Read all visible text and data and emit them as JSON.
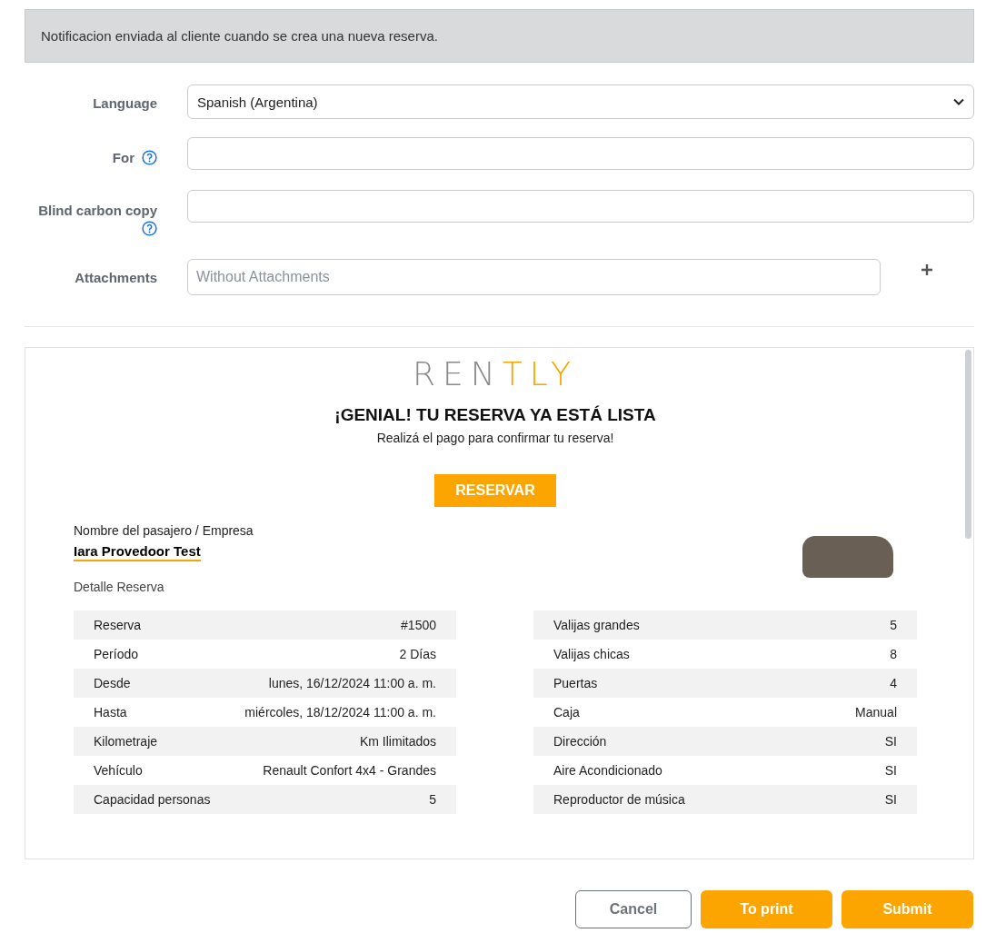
{
  "notice": "Notificacion enviada al cliente cuando se crea una nueva reserva.",
  "form": [
    {
      "kind": "select",
      "label": "Language",
      "value": "Spanish (Argentina)",
      "help": false
    },
    {
      "kind": "text",
      "label": "For",
      "help": true
    },
    {
      "kind": "text",
      "label": "Blind carbon copy",
      "help": true
    },
    {
      "kind": "attach",
      "label": "Attachments",
      "placeholder": "Without Attachments",
      "help": false
    }
  ],
  "preview": {
    "logo": {
      "main": "REN",
      "accent": "TLY"
    },
    "title": "¡GENIAL! TU RESERVA YA ESTÁ LISTA",
    "subtitle": "Realizá el pago para confirmar tu reserva!",
    "cta": "RESERVAR",
    "passenger_label": "Nombre del pasajero / Empresa",
    "passenger_name": "Iara Provedoor Test",
    "section": "Detalle Reserva",
    "left_rows": [
      [
        "Reserva",
        "#1500"
      ],
      [
        "Período",
        "2 Días"
      ],
      [
        "Desde",
        "lunes, 16/12/2024 11:00 a. m."
      ],
      [
        "Hasta",
        "miércoles, 18/12/2024 11:00 a. m."
      ],
      [
        "Kilometraje",
        "Km Ilimitados"
      ],
      [
        "Vehículo",
        "Renault Confort 4x4 - Grandes"
      ],
      [
        "Capacidad personas",
        "5"
      ]
    ],
    "right_rows": [
      [
        "Valijas grandes",
        "5"
      ],
      [
        "Valijas chicas",
        "8"
      ],
      [
        "Puertas",
        "4"
      ],
      [
        "Caja",
        "Manual"
      ],
      [
        "Dirección",
        "SI"
      ],
      [
        "Aire Acondicionado",
        "SI"
      ],
      [
        "Reproductor de música",
        "SI"
      ]
    ]
  },
  "buttons": [
    {
      "kind": "outline",
      "label": "Cancel"
    },
    {
      "kind": "primary",
      "label": "To print"
    },
    {
      "kind": "primary",
      "label": "Submit"
    }
  ]
}
